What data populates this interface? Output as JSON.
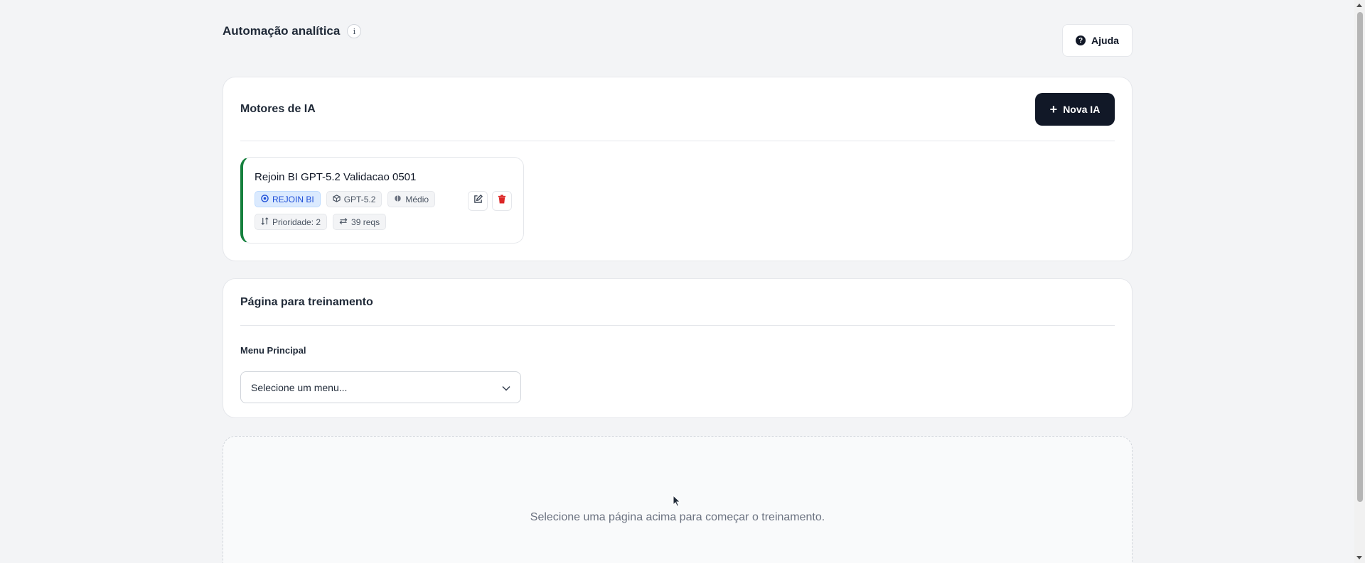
{
  "header": {
    "title": "Automação analítica",
    "info_icon": "info-icon",
    "info_glyph": "i",
    "help_label": "Ajuda",
    "help_glyph": "?"
  },
  "engines": {
    "title": "Motores de IA",
    "new_button_label": "Nova IA",
    "items": [
      {
        "name": "Rejoin BI GPT-5.2 Validacao 0501",
        "status_color": "#15803d",
        "provider": "REJOIN BI",
        "model": "GPT-5.2",
        "level": "Médio",
        "priority": "Prioridade: 2",
        "requests": "39 reqs"
      }
    ]
  },
  "training": {
    "title": "Página para treinamento",
    "menu_label": "Menu Principal",
    "menu_placeholder": "Selecione um menu...",
    "empty_message": "Selecione uma página acima para começar o treinamento."
  },
  "colors": {
    "background": "#f3f4f6",
    "primary_button": "#111827",
    "delete": "#dc2626",
    "badge_blue": "#1d4ed8"
  }
}
